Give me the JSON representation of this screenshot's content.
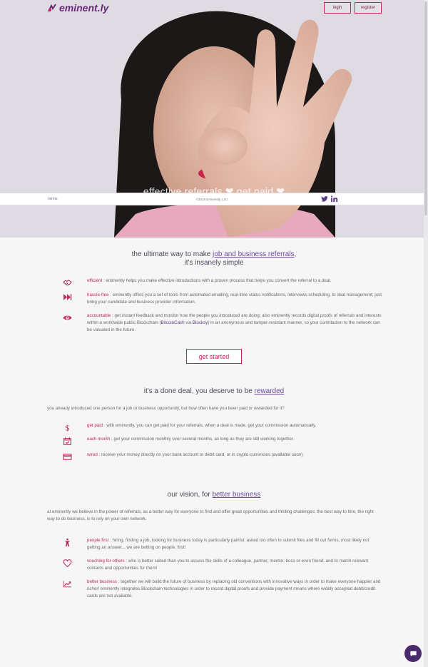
{
  "header": {
    "logo_text": "eminent.ly",
    "login_label": "login",
    "register_label": "register",
    "tagline": "effective referrals ❤ get paid ❤"
  },
  "footer_bar": {
    "terms_label": "terms",
    "copyright": "©2018 Eminently, LLC",
    "social_icons": [
      "twitter-icon",
      "linkedin-icon"
    ]
  },
  "intro_section": {
    "title_prefix": "the ultimate way to make ",
    "title_link": "job and business referrals",
    "title_suffix": ",",
    "subtitle": "it's insanely simple",
    "items": [
      {
        "icon": "handshake-icon",
        "key": "efficient",
        "text": " : eminently helps you make effective introductions with a proven process that helps you convert the referral to a deal."
      },
      {
        "icon": "fast-forward-icon",
        "key": "hassle-free",
        "text": " : eminently offers you a set of tools from automated emailing, real-time status notifications, interviews scheduling, to deal management; just bring your candidate and business provider information."
      },
      {
        "icon": "eye-icon",
        "key": "accountable",
        "text_a": " : get instant feedback and monitor how the people you introduced are doing; also eminently records digital proofs of referrals and interests within a worldwide public Blockchain (",
        "chain1": "BitcoinCash",
        "text_b": " via ",
        "chain2": "Blocksy",
        "text_c": ") in an anonymous and tamper-resistant manner, so your contribution to the network can be valuated in the future."
      }
    ],
    "cta_label": "get started"
  },
  "deal_section": {
    "title_prefix": "it's a done deal, you deserve to be ",
    "title_link": "rewarded",
    "intro": "you already introduced one person for a job or business opportunity, but how often have you been paid or rewarded for it?",
    "items": [
      {
        "icon": "dollar-icon",
        "key": "get paid",
        "text": " : with eminently, you can get paid for your referrals; when a deal is made, get your commission automatically."
      },
      {
        "icon": "calendar-check-icon",
        "key": "each month",
        "text": " : get your commission monthly over several months, as long as they are still working together."
      },
      {
        "icon": "credit-card-icon",
        "key": "wired",
        "text": " : receive your money directly on your bank account or debit card, or in crypto-currencies (available soon)."
      }
    ]
  },
  "vision_section": {
    "title_prefix": "our vision, for ",
    "title_link": "better business",
    "intro": "at eminently we believe in the power of referrals, as a better way for everyone to find and offer great opportunities and thrilling challenges: the best way to hire, the right way to do business, is to rely on your own network.",
    "items": [
      {
        "icon": "person-icon",
        "key": "people first",
        "text": " : hiring, finding a job, looking for business today is particularly painful: asked too often to submit files and fill out forms, most likely not getting an answer... we are betting on people, first!"
      },
      {
        "icon": "heart-icon",
        "key": "vouching for others",
        "text": " : who is better suited than you to assess the skills of a colleague, partner, mentor, boss or even friend, and to match relevant contacts and opportunities for them!"
      },
      {
        "icon": "trending-up-icon",
        "key": "better business",
        "text": " : together we will build the future of business by replacing old conventions with innovative ways in order to make everyone happier and richer! eminently integrates Blockchain technologies in order to record digital proofs and provide payment means where widely accepted debit/credit cards are not available."
      }
    ]
  },
  "colors": {
    "accent": "#c2285a",
    "brand": "#6a2a7a",
    "link": "#6c4a9a"
  }
}
